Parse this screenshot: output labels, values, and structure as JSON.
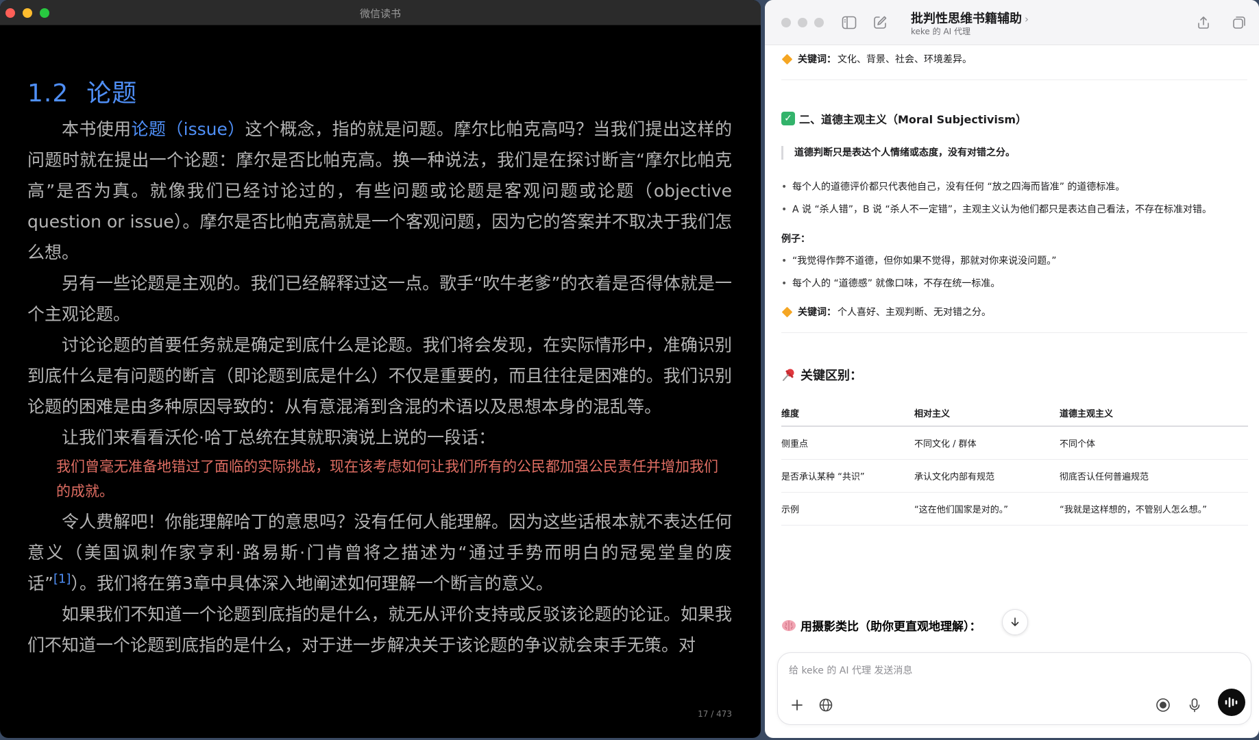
{
  "reader": {
    "window_title": "微信读书",
    "chapter_number": "1.2",
    "chapter_title": "论题",
    "p1_a": "本书使用",
    "p1_link": "论题（issue）",
    "p1_b": "这个概念，指的就是问题。摩尔比帕克高吗？当我们提出这样的问题时就在提出一个论题：摩尔是否比帕克高。换一种说法，我们是在探讨断言“摩尔比帕克高”是否为真。就像我们已经讨论过的，有些问题或论题是客观问题或论题（objective question or issue）。摩尔是否比帕克高就是一个客观问题，因为它的答案并不取决于我们怎么想。",
    "p2": "另有一些论题是主观的。我们已经解释过这一点。歌手“吹牛老爹”的衣着是否得体就是一个主观论题。",
    "p3": "讨论论题的首要任务就是确定到底什么是论题。我们将会发现，在实际情形中，准确识别到底什么是有问题的断言（即论题到底是什么）不仅是重要的，而且往往是困难的。我们识别论题的困难是由多种原因导致的：从有意混淆到含混的术语以及思想本身的混乱等。",
    "p4": "让我们来看看沃伦·哈丁总统在其就职演说上说的一段话：",
    "quote": "我们曾毫无准备地错过了面临的实际挑战，现在该考虑如何让我们所有的公民都加强公民责任并增加我们的成就。",
    "p5_a": "令人费解吧！你能理解哈丁的意思吗？没有任何人能理解。因为这些话根本就不表达任何意义（美国讽刺作家亨利·路易斯·门肯曾将之描述为“通过手势而明白的冠冕堂皇的废话”",
    "footnote": "[1]",
    "p5_b": "）。我们将在第3章中具体深入地阐述如何理解一个断言的意义。",
    "p6": "如果我们不知道一个论题到底指的是什么，就无从评价支持或反驳该论题的论证。如果我们不知道一个论题到底指的是什么，对于进一步解决关于该论题的争议就会束手无策。对",
    "page_indicator": "17 / 473"
  },
  "chat": {
    "title": "批判性思维书籍辅助",
    "subtitle": "keke 的 AI 代理",
    "kw1_label": "关键词：",
    "kw1_text": "文化、背景、社会、环境差异。",
    "section2_title": "二、道德主观主义（Moral Subjectivism）",
    "section2_quote": "道德判断只是表达个人情绪或态度，没有对错之分。",
    "bullets": [
      "每个人的道德评价都只代表他自己，没有任何 “放之四海而皆准” 的道德标准。",
      "A 说 “杀人错”，B 说 “杀人不一定错”，主观主义认为他们都只是表达自己看法，不存在标准对错。"
    ],
    "example_label": "例子：",
    "examples": [
      "“我觉得作弊不道德，但你如果不觉得，那就对你来说没问题。”",
      "每个人的 “道德感” 就像口味，不存在统一标准。"
    ],
    "kw2_label": "关键词：",
    "kw2_text": "个人喜好、主观判断、无对错之分。",
    "key_diff_title": "关键区别：",
    "table": {
      "headers": [
        "维度",
        "相对主义",
        "道德主观主义"
      ],
      "rows": [
        [
          "侧重点",
          "不同文化 / 群体",
          "不同个体"
        ],
        [
          "是否承认某种 “共识”",
          "承认文化内部有规范",
          "彻底否认任何普遍规范"
        ],
        [
          "示例",
          "“这在他们国家是对的。”",
          "“我就是这样想的，不管别人怎么想。”"
        ]
      ]
    },
    "analogy_title": "用摄影类比（助你更直观地理解）：",
    "composer_placeholder": "给 keke 的 AI 代理 发送消息"
  },
  "colors": {
    "accent_blue": "#4f8ff7",
    "quote_red": "#e06e63",
    "check_green": "#33b36b",
    "diamond_orange": "#f5a623"
  }
}
